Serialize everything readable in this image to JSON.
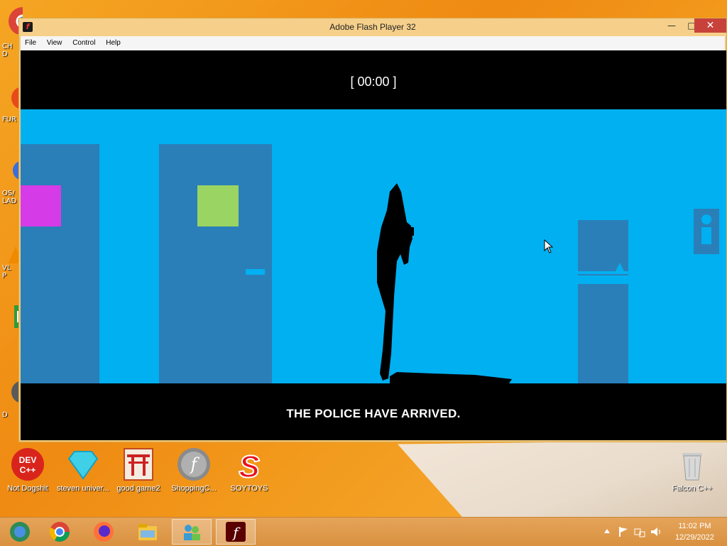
{
  "window": {
    "title": "Adobe Flash Player 32",
    "minimize": "—",
    "maximize": "□",
    "close": "✕"
  },
  "menu": [
    "File",
    "View",
    "Control",
    "Help"
  ],
  "game": {
    "timer": "[ 00:00 ]",
    "caption": "THE POLICE HAVE ARRIVED."
  },
  "desktop_left": [
    "CH\nD",
    "FUR",
    "OS/\nLAD",
    "VL\nP",
    "D"
  ],
  "desktop_icons": [
    {
      "label": "Not Dogshit",
      "icon": "dev-cpp-icon"
    },
    {
      "label": "steven univer...",
      "icon": "diamond-icon"
    },
    {
      "label": "good game2",
      "icon": "torii-gate-icon"
    },
    {
      "label": "ShoppingC...",
      "icon": "flash-icon"
    },
    {
      "label": "SOYTOYS",
      "icon": "s-logo-icon"
    },
    {
      "label": "Falcon C++",
      "icon": "recycle-bin-icon"
    }
  ],
  "taskbar": {
    "apps": [
      "explorer-icon",
      "chrome-icon",
      "firefox-icon",
      "file-explorer-icon",
      "people-icon",
      "flash-player-icon"
    ],
    "time": "11:02 PM",
    "date": "12/29/2022"
  },
  "colors": {
    "scene_bg": "#00b0f0",
    "door": "#2a7fb8",
    "magenta_block": "#d63be8",
    "green_block": "#9ad462"
  }
}
